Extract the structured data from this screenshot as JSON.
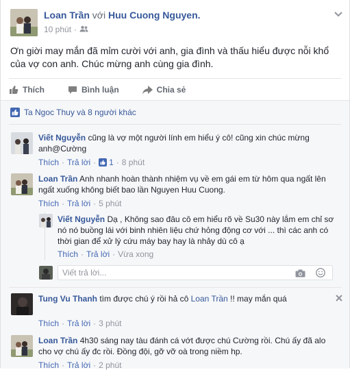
{
  "post": {
    "author": "Loan Trần",
    "with_word": "với",
    "tagged": "Huu Cuong Nguyen.",
    "time": "10 phút",
    "body": "Ơn giời may mắn đã mỉm cười với anh, gia đình và thấu hiểu được nỗi khổ của vợ con anh. Chúc mừng anh cùng gia đình."
  },
  "actions": {
    "like": "Thích",
    "comment": "Bình luận",
    "share": "Chia sẻ"
  },
  "likes_summary": "Ta Ngoc Thuy và 8 người khác",
  "comments": [
    {
      "author": "Viết Nguyễn",
      "text": "cũng là vợ một người lính em hiểu ý cô! cũng xin chúc mừng anh@Cường",
      "like": "Thích",
      "reply": "Trả lời",
      "like_count": "1",
      "time": "8 phút"
    },
    {
      "author": "Loan Trần",
      "text": "Anh nhanh hoàn thành nhiệm vụ về em gái em từ hôm qua ngất lên ngất xuống không biết bao lần Nguyen Huu Cuong.",
      "like": "Thích",
      "reply": "Trả lời",
      "time": "5 phút"
    },
    {
      "author": "Tung Vu Thanh",
      "text_before": "tìm được chú ý rồi hả cô",
      "mention": "Loan Trần",
      "text_after": "!! may mắn quá",
      "like": "Thích",
      "reply": "Trả lời",
      "time": "3 phút"
    },
    {
      "author": "Loan Trần",
      "text": "4h30 sáng nay tàu đánh cá vớt được chú Cường rồi. Chú ấy đã alo cho vợ chú ấy đc rồi. Đồng đội, gỡ vỡ oà trong niềm hp.",
      "like": "Thích",
      "reply": "Trả lời",
      "time": "2 phút"
    }
  ],
  "reply": {
    "author": "Viết Nguyễn",
    "text": "Dạ , Không sao đâu cô em hiểu rõ về Su30 này lắm em chỉ sơ nó nó buồng lái với binh nhiên liệu chứ hỏng động cơ với ... thì các anh có thời gian để xử lý cứu máy bay hay là nhảy dù cô ạ",
    "like": "Thích",
    "reply": "Trả lời",
    "time": "Vừa xong",
    "separator": "·"
  },
  "reply_input": {
    "placeholder": "Viết trả lời..."
  },
  "colors": {
    "link": "#365899",
    "meta": "#90949c",
    "comment_bg": "#f6f7f9",
    "like_blue": "#4267b2"
  }
}
